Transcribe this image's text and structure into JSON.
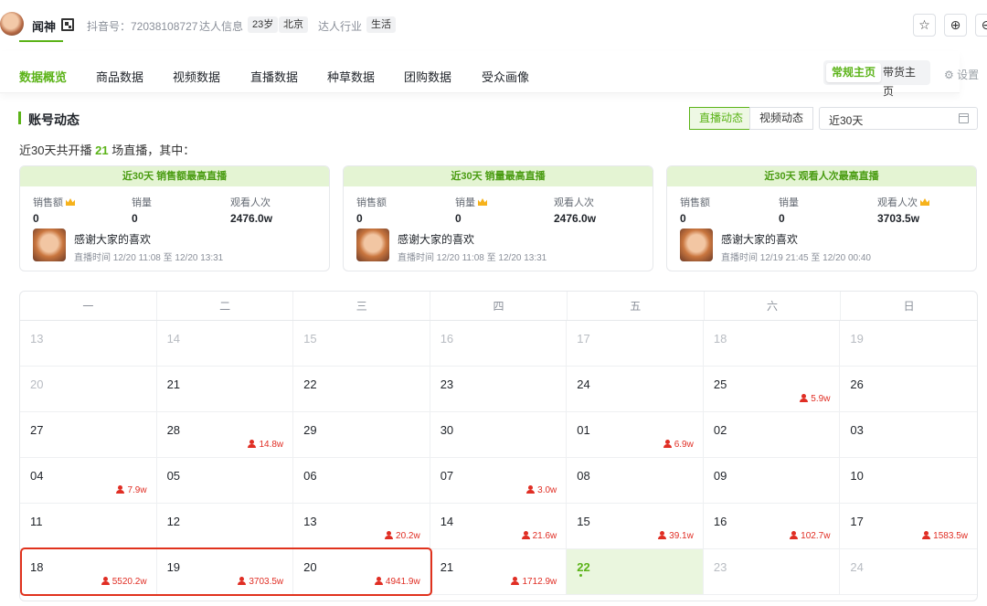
{
  "profile": {
    "name": "闻神",
    "douyin_id_label": "抖音号：72038108727",
    "influencer_info_label": "达人信息",
    "age": "23岁",
    "city": "北京",
    "industry_label": "达人行业",
    "industry": "生活"
  },
  "toolbar_icons": [
    "star-icon",
    "plus-circle-icon",
    "minus-circle-icon"
  ],
  "tabs": [
    {
      "label": "数据概览",
      "active": true
    },
    {
      "label": "商品数据"
    },
    {
      "label": "视频数据"
    },
    {
      "label": "直播数据"
    },
    {
      "label": "种草数据"
    },
    {
      "label": "团购数据"
    },
    {
      "label": "受众画像"
    }
  ],
  "page_switch": {
    "regular": "常规主页",
    "goods": "带货主页",
    "active": "常规主页"
  },
  "settings_label": "设置",
  "section": {
    "title": "账号动态",
    "filter_live": "直播动态",
    "filter_video": "视频动态",
    "active_filter": "直播动态",
    "date_range": "近30天"
  },
  "summary": {
    "prefix": "近30天共开播",
    "count": "21",
    "suffix": "场直播，其中："
  },
  "cards": [
    {
      "title": "近30天 销售额最高直播",
      "stats": [
        {
          "label": "销售额",
          "value": "0",
          "crown": true
        },
        {
          "label": "销量",
          "value": "0"
        },
        {
          "label": "观看人次",
          "value": "2476.0w"
        }
      ],
      "live_title": "感谢大家的喜欢",
      "live_time": "直播时间 12/20 11:08 至 12/20 13:31"
    },
    {
      "title": "近30天 销量最高直播",
      "stats": [
        {
          "label": "销售额",
          "value": "0"
        },
        {
          "label": "销量",
          "value": "0",
          "crown": true
        },
        {
          "label": "观看人次",
          "value": "2476.0w"
        }
      ],
      "live_title": "感谢大家的喜欢",
      "live_time": "直播时间 12/20 11:08 至 12/20 13:31"
    },
    {
      "title": "近30天 观看人次最高直播",
      "stats": [
        {
          "label": "销售额",
          "value": "0"
        },
        {
          "label": "销量",
          "value": "0"
        },
        {
          "label": "观看人次",
          "value": "3703.5w",
          "crown": true
        }
      ],
      "live_title": "感谢大家的喜欢",
      "live_time": "直播时间 12/19 21:45 至 12/20 00:40"
    }
  ],
  "calendar": {
    "weekdays": [
      "一",
      "二",
      "三",
      "四",
      "五",
      "六",
      "日"
    ],
    "cells": [
      {
        "d": "13",
        "muted": true
      },
      {
        "d": "14",
        "muted": true
      },
      {
        "d": "15",
        "muted": true
      },
      {
        "d": "16",
        "muted": true
      },
      {
        "d": "17",
        "muted": true
      },
      {
        "d": "18",
        "muted": true
      },
      {
        "d": "19",
        "muted": true
      },
      {
        "d": "20",
        "muted": true
      },
      {
        "d": "21"
      },
      {
        "d": "22"
      },
      {
        "d": "23"
      },
      {
        "d": "24"
      },
      {
        "d": "25",
        "v": "5.9w"
      },
      {
        "d": "26"
      },
      {
        "d": "27"
      },
      {
        "d": "28",
        "v": "14.8w"
      },
      {
        "d": "29"
      },
      {
        "d": "30"
      },
      {
        "d": "01",
        "v": "6.9w"
      },
      {
        "d": "02"
      },
      {
        "d": "03"
      },
      {
        "d": "04",
        "v": "7.9w"
      },
      {
        "d": "05"
      },
      {
        "d": "06"
      },
      {
        "d": "07",
        "v": "3.0w"
      },
      {
        "d": "08"
      },
      {
        "d": "09"
      },
      {
        "d": "10"
      },
      {
        "d": "11"
      },
      {
        "d": "12"
      },
      {
        "d": "13",
        "v": "20.2w"
      },
      {
        "d": "14",
        "v": "21.6w"
      },
      {
        "d": "15",
        "v": "39.1w"
      },
      {
        "d": "16",
        "v": "102.7w"
      },
      {
        "d": "17",
        "v": "1583.5w"
      },
      {
        "d": "18",
        "v": "5520.2w"
      },
      {
        "d": "19",
        "v": "3703.5w"
      },
      {
        "d": "20",
        "v": "4941.9w"
      },
      {
        "d": "21",
        "v": "1712.9w"
      },
      {
        "d": "22",
        "today": true
      },
      {
        "d": "23",
        "muted": true
      },
      {
        "d": "24",
        "muted": true
      }
    ]
  },
  "colors": {
    "accent": "#5bb318",
    "viewer_red": "#e02e24",
    "highlight_red": "#e0321d"
  }
}
